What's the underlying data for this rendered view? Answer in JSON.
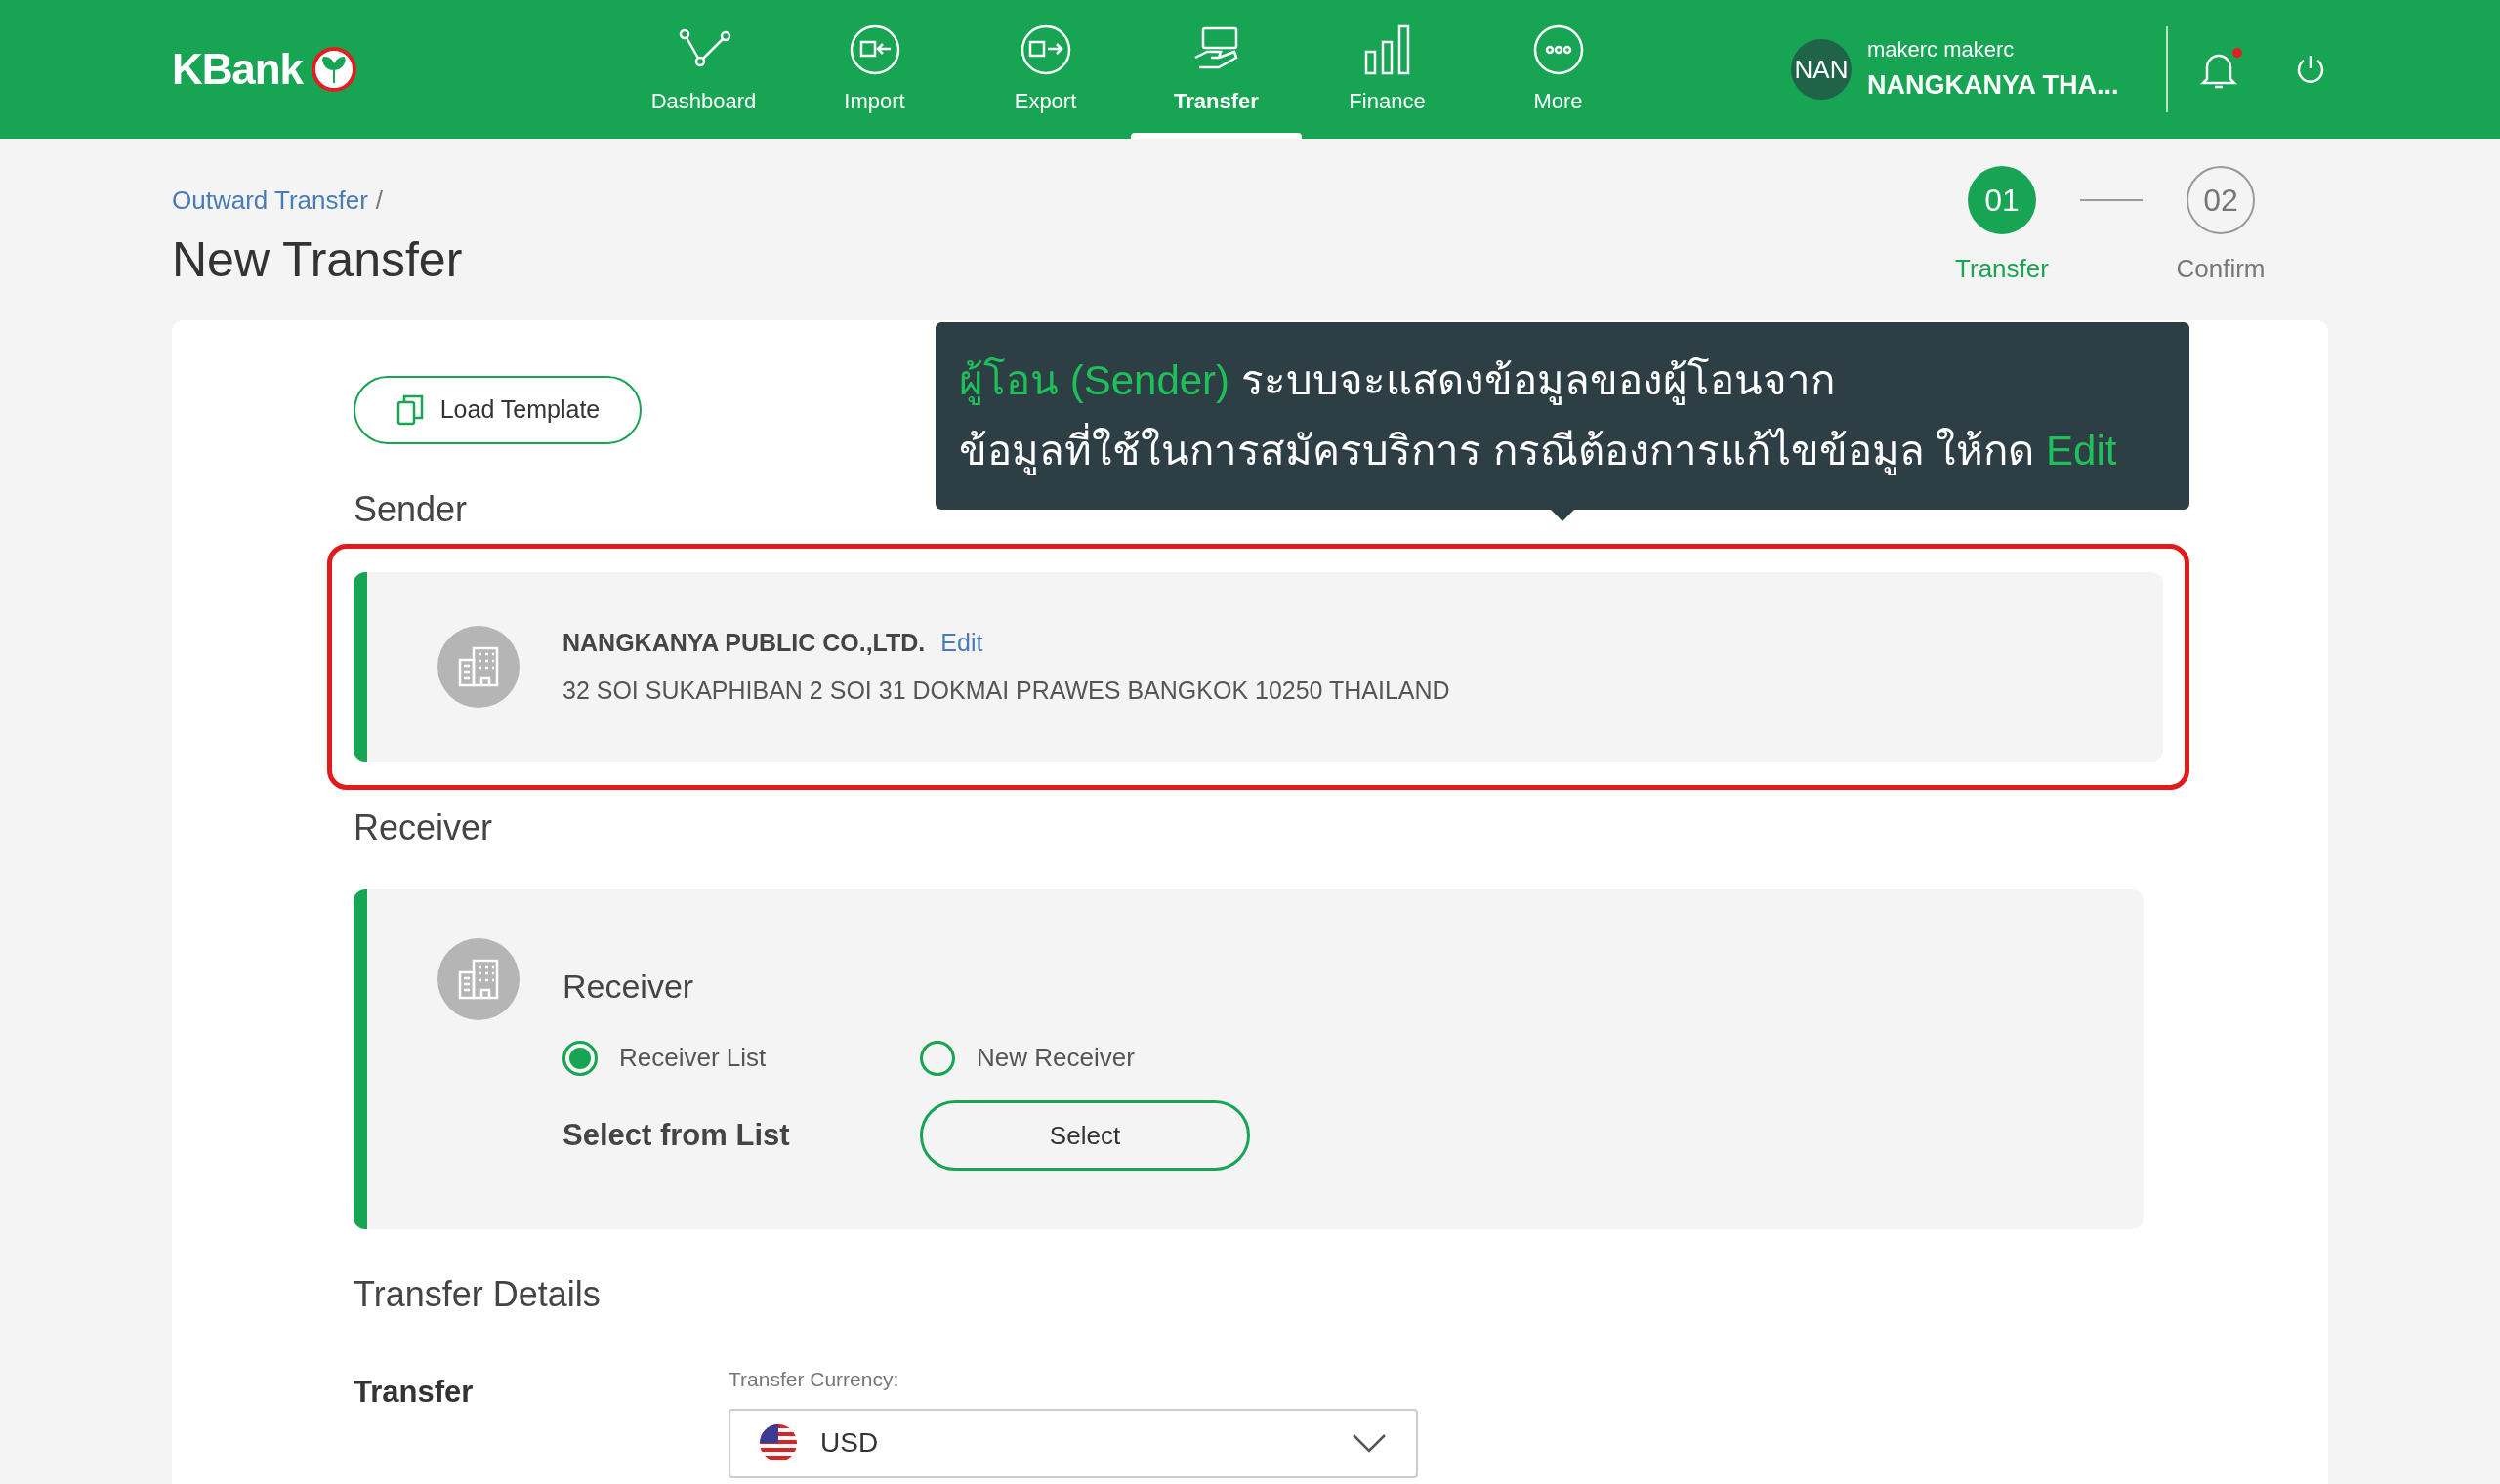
{
  "brand": {
    "name": "KBank"
  },
  "nav": [
    {
      "label": "Dashboard",
      "kind": "dashboard",
      "selected": false
    },
    {
      "label": "Import",
      "kind": "import",
      "selected": false
    },
    {
      "label": "Export",
      "kind": "export",
      "selected": false
    },
    {
      "label": "Transfer",
      "kind": "transfer",
      "selected": true
    },
    {
      "label": "Finance",
      "kind": "finance",
      "selected": false
    },
    {
      "label": "More",
      "kind": "more",
      "selected": false
    }
  ],
  "user": {
    "avatar": "NAN",
    "name": "makerc makerc",
    "company": "NANGKANYA THA..."
  },
  "notifications": {
    "unread": true
  },
  "breadcrumb": {
    "items": [
      "Outward Transfer"
    ],
    "separator": "/"
  },
  "title": "New Transfer",
  "steps": [
    {
      "number": "01",
      "label": "Transfer",
      "selected": true
    },
    {
      "number": "02",
      "label": "Confirm",
      "selected": false
    }
  ],
  "load_template": "Load Template",
  "tooltip": {
    "lines": [
      [
        {
          "text": "ผู้โอน (Sender)",
          "highlight": true
        },
        {
          "text": " ระบบจะแสดงข้อมูลของผู้โอนจาก",
          "highlight": false
        }
      ],
      [
        {
          "text": "ข้อมูลที่ใช้ในการสมัครบริการ กรณีต้องการแก้ไขข้อมูล ให้กด ",
          "highlight": false
        },
        {
          "text": "Edit",
          "highlight": true
        }
      ]
    ]
  },
  "sender": {
    "heading": "Sender",
    "highlighted": true,
    "name": "NANGKANYA PUBLIC CO.,LTD.",
    "edit": "Edit",
    "address": "32 SOI SUKAPHIBAN 2 SOI 31 DOKMAI PRAWES BANGKOK 10250 THAILAND"
  },
  "receiver": {
    "heading": "Receiver",
    "title": "Receiver",
    "options": [
      {
        "label": "Receiver List",
        "selected": true
      },
      {
        "label": "New Receiver",
        "selected": false
      }
    ],
    "select_label": "Select from List",
    "select_button": "Select"
  },
  "transfer_details": {
    "heading": "Transfer Details",
    "row_label": "Transfer",
    "currency_label": "Transfer Currency:",
    "currency": "USD"
  }
}
